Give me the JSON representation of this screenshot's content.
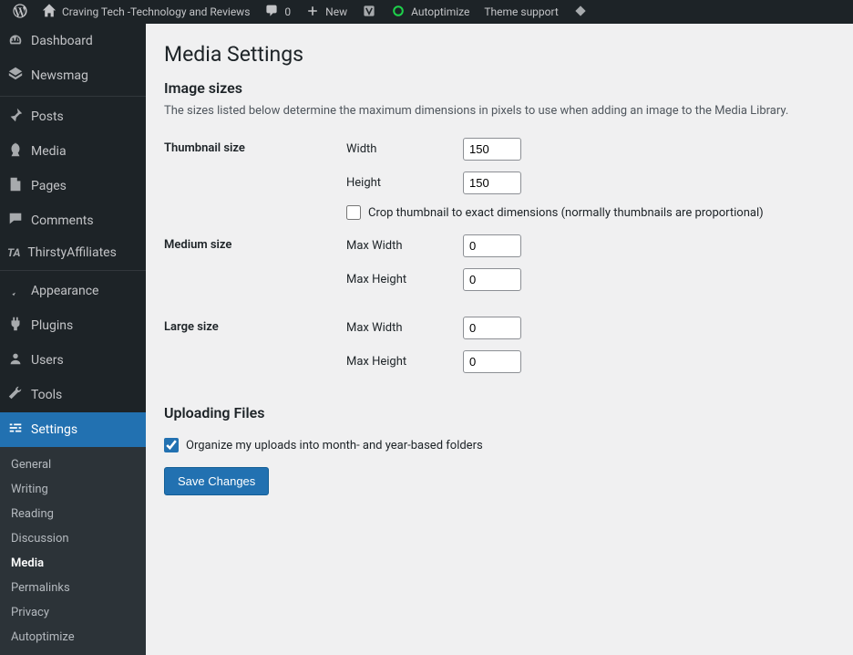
{
  "toolbar": {
    "site_name": "Craving Tech -Technology and Reviews",
    "comments_count": "0",
    "new_label": "New",
    "autoptimize": "Autoptimize",
    "theme_support": "Theme support"
  },
  "sidebar": {
    "items": [
      {
        "label": "Dashboard"
      },
      {
        "label": "Newsmag"
      },
      {
        "label": "Posts"
      },
      {
        "label": "Media"
      },
      {
        "label": "Pages"
      },
      {
        "label": "Comments"
      },
      {
        "label": "ThirstyAffiliates"
      },
      {
        "label": "Appearance"
      },
      {
        "label": "Plugins"
      },
      {
        "label": "Users"
      },
      {
        "label": "Tools"
      },
      {
        "label": "Settings"
      }
    ],
    "settings_submenu": [
      {
        "label": "General"
      },
      {
        "label": "Writing"
      },
      {
        "label": "Reading"
      },
      {
        "label": "Discussion"
      },
      {
        "label": "Media"
      },
      {
        "label": "Permalinks"
      },
      {
        "label": "Privacy"
      },
      {
        "label": "Autoptimize"
      }
    ]
  },
  "page": {
    "title": "Media Settings",
    "image_sizes_heading": "Image sizes",
    "image_sizes_desc": "The sizes listed below determine the maximum dimensions in pixels to use when adding an image to the Media Library.",
    "thumbnail": {
      "label": "Thumbnail size",
      "width_label": "Width",
      "width_value": "150",
      "height_label": "Height",
      "height_value": "150",
      "crop_label": "Crop thumbnail to exact dimensions (normally thumbnails are proportional)"
    },
    "medium": {
      "label": "Medium size",
      "max_width_label": "Max Width",
      "max_width_value": "0",
      "max_height_label": "Max Height",
      "max_height_value": "0"
    },
    "large": {
      "label": "Large size",
      "max_width_label": "Max Width",
      "max_width_value": "0",
      "max_height_label": "Max Height",
      "max_height_value": "0"
    },
    "uploading_heading": "Uploading Files",
    "organize_label": "Organize my uploads into month- and year-based folders",
    "save_label": "Save Changes"
  }
}
